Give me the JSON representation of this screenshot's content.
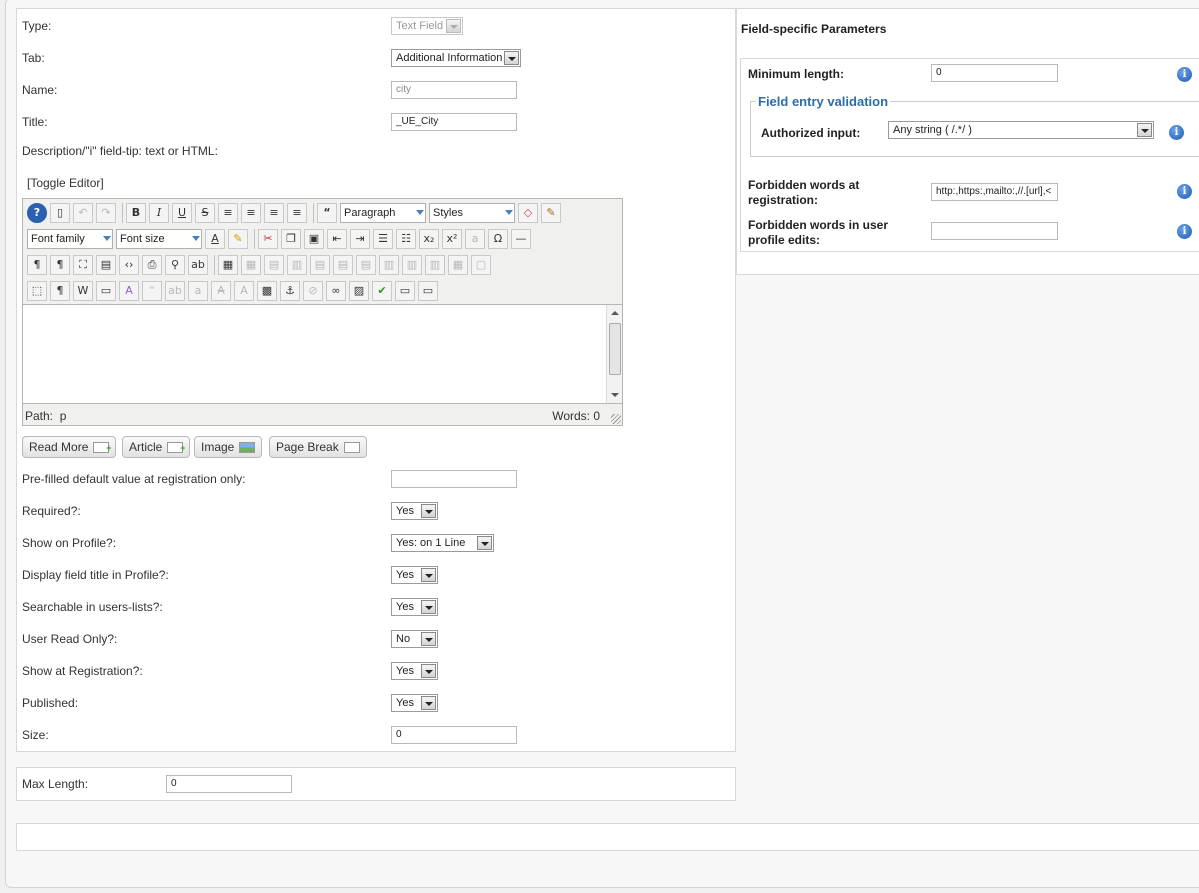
{
  "left_form": {
    "type": {
      "label": "Type:",
      "value": "Text Field"
    },
    "tab": {
      "label": "Tab:",
      "value": "Additional Information"
    },
    "name": {
      "label": "Name:",
      "value": "city"
    },
    "title": {
      "label": "Title:",
      "value": "_UE_City"
    },
    "description": {
      "label": "Description/\"i\" field-tip: text or HTML:"
    },
    "toggle_editor": "[Toggle Editor]",
    "editor": {
      "format_select": "Paragraph",
      "styles_select": "Styles",
      "font_family": "Font family",
      "font_size": "Font size",
      "path_label": "Path:",
      "path_value": "p",
      "word_count": "Words: 0"
    },
    "editor_buttons": {
      "read_more": "Read More",
      "article": "Article",
      "image": "Image",
      "page_break": "Page Break"
    },
    "prefilled": {
      "label": "Pre-filled default value at registration only:",
      "value": ""
    },
    "required": {
      "label": "Required?:",
      "value": "Yes"
    },
    "show_on_profile": {
      "label": "Show on Profile?:",
      "value": "Yes: on 1 Line"
    },
    "display_title": {
      "label": "Display field title in Profile?:",
      "value": "Yes"
    },
    "searchable": {
      "label": "Searchable in users-lists?:",
      "value": "Yes"
    },
    "read_only": {
      "label": "User Read Only?:",
      "value": "No"
    },
    "show_registration": {
      "label": "Show at Registration?:",
      "value": "Yes"
    },
    "published": {
      "label": "Published:",
      "value": "Yes"
    },
    "size": {
      "label": "Size:",
      "value": "0"
    }
  },
  "max_length": {
    "label": "Max Length:",
    "value": "0"
  },
  "right_panel": {
    "title": "Field-specific Parameters",
    "min_length": {
      "label": "Minimum length:",
      "value": "0"
    },
    "validation_legend": "Field entry validation",
    "authorized_input": {
      "label": "Authorized input:",
      "value": "Any string ( /.*/ )"
    },
    "forbidden_registration": {
      "label_line1": "Forbidden words at",
      "label_line2": "registration:",
      "value": "http:,https:,mailto:,//.[url],<"
    },
    "forbidden_profile": {
      "label_line1": "Forbidden words in user",
      "label_line2": "profile edits:",
      "value": ""
    },
    "info_glyph": "i"
  },
  "colors": {
    "legend": "#2e6ca4",
    "info_icon": "#1c58b5"
  }
}
